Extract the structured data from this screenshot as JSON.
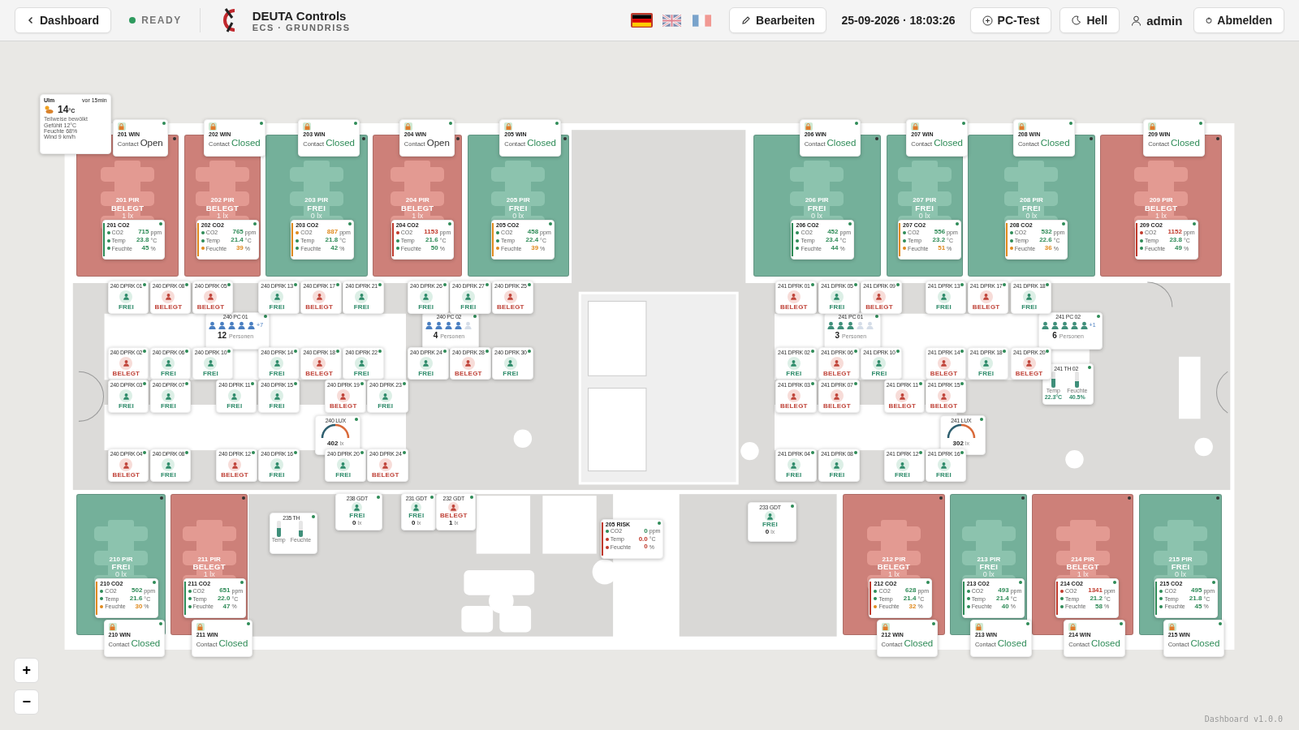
{
  "header": {
    "back": "Dashboard",
    "status": "READY",
    "brand": "DEUTA Controls",
    "subtitle": "ECS · GRUNDRISS",
    "languages": [
      {
        "kind": "de",
        "selected": true
      },
      {
        "kind": "en",
        "selected": false
      },
      {
        "kind": "fr",
        "selected": false
      }
    ],
    "edit": "Bearbeiten",
    "datetime": "25-09-2026 · 18:03:26",
    "pc_test": "PC-Test",
    "theme": "Hell",
    "user": "admin",
    "logout": "Abmelden"
  },
  "weather": {
    "city": "Ulm",
    "age": "vor 15min",
    "temp": "14",
    "unit": "°C",
    "condition": "Teilweise bewölkt",
    "details": [
      "Gefühlt 12°C",
      "Feuchte 68%",
      "Wind 9 km/h"
    ]
  },
  "rooms": [
    {
      "name": "201 PIR",
      "status": "BELEGT",
      "lux": "1 lx",
      "occupied": true
    },
    {
      "name": "202 PIR",
      "status": "BELEGT",
      "lux": "1 lx",
      "occupied": true
    },
    {
      "name": "203 PIR",
      "status": "FREI",
      "lux": "0 lx",
      "occupied": false
    },
    {
      "name": "204 PIR",
      "status": "BELEGT",
      "lux": "1 lx",
      "occupied": true
    },
    {
      "name": "205 PIR",
      "status": "FREI",
      "lux": "0 lx",
      "occupied": false
    },
    {
      "name": "206 PIR",
      "status": "FREI",
      "lux": "0 lx",
      "occupied": false
    },
    {
      "name": "207 PIR",
      "status": "FREI",
      "lux": "0 lx",
      "occupied": false
    },
    {
      "name": "208 PIR",
      "status": "FREI",
      "lux": "0 lx",
      "occupied": false
    },
    {
      "name": "209 PIR",
      "status": "BELEGT",
      "lux": "1 lx",
      "occupied": true
    },
    {
      "name": "210 PIR",
      "status": "FREI",
      "lux": "0 lx",
      "occupied": false
    },
    {
      "name": "211 PIR",
      "status": "BELEGT",
      "lux": "1 lx",
      "occupied": true
    },
    {
      "name": "212 PIR",
      "status": "BELEGT",
      "lux": "1 lx",
      "occupied": true
    },
    {
      "name": "213 PIR",
      "status": "FREI",
      "lux": "0 lx",
      "occupied": false
    },
    {
      "name": "214 PIR",
      "status": "BELEGT",
      "lux": "1 lx",
      "occupied": true
    },
    {
      "name": "215 PIR",
      "status": "FREI",
      "lux": "0 lx",
      "occupied": false
    }
  ],
  "windows": [
    {
      "name": "201 WIN",
      "label": "Contact",
      "value": "Open",
      "closed": false
    },
    {
      "name": "202 WIN",
      "label": "Contact",
      "value": "Closed",
      "closed": true
    },
    {
      "name": "203 WIN",
      "label": "Contact",
      "value": "Closed",
      "closed": true
    },
    {
      "name": "204 WIN",
      "label": "Contact",
      "value": "Open",
      "closed": false
    },
    {
      "name": "205 WIN",
      "label": "Contact",
      "value": "Closed",
      "closed": true
    },
    {
      "name": "206 WIN",
      "label": "Contact",
      "value": "Closed",
      "closed": true
    },
    {
      "name": "207 WIN",
      "label": "Contact",
      "value": "Closed",
      "closed": true
    },
    {
      "name": "208 WIN",
      "label": "Contact",
      "value": "Closed",
      "closed": true
    },
    {
      "name": "209 WIN",
      "label": "Contact",
      "value": "Closed",
      "closed": true
    },
    {
      "name": "210 WIN",
      "label": "Contact",
      "value": "Closed",
      "closed": true
    },
    {
      "name": "211 WIN",
      "label": "Contact",
      "value": "Closed",
      "closed": true
    },
    {
      "name": "212 WIN",
      "label": "Contact",
      "value": "Closed",
      "closed": true
    },
    {
      "name": "213 WIN",
      "label": "Contact",
      "value": "Closed",
      "closed": true
    },
    {
      "name": "214 WIN",
      "label": "Contact",
      "value": "Closed",
      "closed": true
    },
    {
      "name": "215 WIN",
      "label": "Contact",
      "value": "Closed",
      "closed": true
    }
  ],
  "sensors": [
    {
      "name": "201 CO2",
      "color": "#2e8b57",
      "metrics": [
        {
          "label": "CO2",
          "value": "715",
          "unit": "ppm",
          "color": "#2e8b57"
        },
        {
          "label": "Temp",
          "value": "23.8",
          "unit": "°C",
          "color": "#2e8b57"
        },
        {
          "label": "Feuchte",
          "value": "45",
          "unit": "%",
          "color": "#2e8b57"
        }
      ]
    },
    {
      "name": "202 CO2",
      "color": "#e08a1e",
      "metrics": [
        {
          "label": "CO2",
          "value": "765",
          "unit": "ppm",
          "color": "#2e8b57"
        },
        {
          "label": "Temp",
          "value": "21.4",
          "unit": "°C",
          "color": "#2e8b57"
        },
        {
          "label": "Feuchte",
          "value": "39",
          "unit": "%",
          "color": "#e08a1e"
        }
      ]
    },
    {
      "name": "203 CO2",
      "color": "#e08a1e",
      "metrics": [
        {
          "label": "CO2",
          "value": "887",
          "unit": "ppm",
          "color": "#e08a1e"
        },
        {
          "label": "Temp",
          "value": "21.8",
          "unit": "°C",
          "color": "#2e8b57"
        },
        {
          "label": "Feuchte",
          "value": "42",
          "unit": "%",
          "color": "#2e8b57"
        }
      ]
    },
    {
      "name": "204 CO2",
      "color": "#c0392b",
      "metrics": [
        {
          "label": "CO2",
          "value": "1153",
          "unit": "ppm",
          "color": "#c0392b"
        },
        {
          "label": "Temp",
          "value": "21.6",
          "unit": "°C",
          "color": "#2e8b57"
        },
        {
          "label": "Feuchte",
          "value": "50",
          "unit": "%",
          "color": "#2e8b57"
        }
      ]
    },
    {
      "name": "205 CO2",
      "color": "#e08a1e",
      "metrics": [
        {
          "label": "CO2",
          "value": "458",
          "unit": "ppm",
          "color": "#2e8b57"
        },
        {
          "label": "Temp",
          "value": "22.4",
          "unit": "°C",
          "color": "#2e8b57"
        },
        {
          "label": "Feuchte",
          "value": "39",
          "unit": "%",
          "color": "#e08a1e"
        }
      ]
    },
    {
      "name": "206 CO2",
      "color": "#2e8b57",
      "metrics": [
        {
          "label": "CO2",
          "value": "452",
          "unit": "ppm",
          "color": "#2e8b57"
        },
        {
          "label": "Temp",
          "value": "23.4",
          "unit": "°C",
          "color": "#2e8b57"
        },
        {
          "label": "Feuchte",
          "value": "44",
          "unit": "%",
          "color": "#2e8b57"
        }
      ]
    },
    {
      "name": "207 CO2",
      "color": "#e08a1e",
      "metrics": [
        {
          "label": "CO2",
          "value": "556",
          "unit": "ppm",
          "color": "#2e8b57"
        },
        {
          "label": "Temp",
          "value": "23.2",
          "unit": "°C",
          "color": "#2e8b57"
        },
        {
          "label": "Feuchte",
          "value": "51",
          "unit": "%",
          "color": "#e08a1e"
        }
      ]
    },
    {
      "name": "208 CO2",
      "color": "#e08a1e",
      "metrics": [
        {
          "label": "CO2",
          "value": "532",
          "unit": "ppm",
          "color": "#2e8b57"
        },
        {
          "label": "Temp",
          "value": "22.6",
          "unit": "°C",
          "color": "#2e8b57"
        },
        {
          "label": "Feuchte",
          "value": "36",
          "unit": "%",
          "color": "#e08a1e"
        }
      ]
    },
    {
      "name": "209 CO2",
      "color": "#c0392b",
      "metrics": [
        {
          "label": "CO2",
          "value": "1152",
          "unit": "ppm",
          "color": "#c0392b"
        },
        {
          "label": "Temp",
          "value": "23.8",
          "unit": "°C",
          "color": "#2e8b57"
        },
        {
          "label": "Feuchte",
          "value": "49",
          "unit": "%",
          "color": "#2e8b57"
        }
      ]
    },
    {
      "name": "210 CO2",
      "color": "#e08a1e",
      "metrics": [
        {
          "label": "CO2",
          "value": "502",
          "unit": "ppm",
          "color": "#2e8b57"
        },
        {
          "label": "Temp",
          "value": "21.6",
          "unit": "°C",
          "color": "#2e8b57"
        },
        {
          "label": "Feuchte",
          "value": "30",
          "unit": "%",
          "color": "#e08a1e"
        }
      ]
    },
    {
      "name": "211 CO2",
      "color": "#2e8b57",
      "metrics": [
        {
          "label": "CO2",
          "value": "651",
          "unit": "ppm",
          "color": "#2e8b57"
        },
        {
          "label": "Temp",
          "value": "22.0",
          "unit": "°C",
          "color": "#2e8b57"
        },
        {
          "label": "Feuchte",
          "value": "47",
          "unit": "%",
          "color": "#2e8b57"
        }
      ]
    },
    {
      "name": "212 CO2",
      "color": "#c0392b",
      "metrics": [
        {
          "label": "CO2",
          "value": "628",
          "unit": "ppm",
          "color": "#2e8b57"
        },
        {
          "label": "Temp",
          "value": "21.4",
          "unit": "°C",
          "color": "#2e8b57"
        },
        {
          "label": "Feuchte",
          "value": "32",
          "unit": "%",
          "color": "#e08a1e"
        }
      ]
    },
    {
      "name": "213 CO2",
      "color": "#2e8b57",
      "metrics": [
        {
          "label": "CO2",
          "value": "493",
          "unit": "ppm",
          "color": "#2e8b57"
        },
        {
          "label": "Temp",
          "value": "21.4",
          "unit": "°C",
          "color": "#2e8b57"
        },
        {
          "label": "Feuchte",
          "value": "40",
          "unit": "%",
          "color": "#2e8b57"
        }
      ]
    },
    {
      "name": "214 CO2",
      "color": "#c0392b",
      "metrics": [
        {
          "label": "CO2",
          "value": "1341",
          "unit": "ppm",
          "color": "#c0392b"
        },
        {
          "label": "Temp",
          "value": "21.2",
          "unit": "°C",
          "color": "#2e8b57"
        },
        {
          "label": "Feuchte",
          "value": "58",
          "unit": "%",
          "color": "#2e8b57"
        }
      ]
    },
    {
      "name": "215 CO2",
      "color": "#2e8b57",
      "metrics": [
        {
          "label": "CO2",
          "value": "495",
          "unit": "ppm",
          "color": "#2e8b57"
        },
        {
          "label": "Temp",
          "value": "21.8",
          "unit": "°C",
          "color": "#2e8b57"
        },
        {
          "label": "Feuchte",
          "value": "45",
          "unit": "%",
          "color": "#2e8b57"
        }
      ]
    },
    {
      "name": "205 RISK",
      "color": "#c0392b",
      "metrics": [
        {
          "label": "CO2",
          "value": "0",
          "unit": "ppm",
          "color": "#2e8b57"
        },
        {
          "label": "Temp",
          "value": "0.0",
          "unit": "°C",
          "color": "#c0392b"
        },
        {
          "label": "Feuchte",
          "value": "0",
          "unit": "%",
          "color": "#c0392b"
        }
      ]
    }
  ],
  "counters": [
    {
      "name": "240 PC 01",
      "count": "12",
      "unit": "Personen",
      "extra": "+7",
      "color": "#4a7fc1",
      "icons": [
        {
          "filled": true
        },
        {
          "filled": true
        },
        {
          "filled": true
        },
        {
          "filled": true
        },
        {
          "filled": true
        }
      ]
    },
    {
      "name": "240 PC 02",
      "count": "4",
      "unit": "Personen",
      "color": "#4a7fc1",
      "icons": [
        {
          "filled": true
        },
        {
          "filled": true
        },
        {
          "filled": true
        },
        {
          "filled": true
        },
        {
          "filled": false
        }
      ]
    },
    {
      "name": "241 PC 01",
      "count": "3",
      "unit": "Personen",
      "color": "#3f8f7a",
      "icons": [
        {
          "filled": true
        },
        {
          "filled": true
        },
        {
          "filled": true
        },
        {
          "filled": false
        },
        {
          "filled": false
        }
      ]
    },
    {
      "name": "241 PC 02",
      "count": "6",
      "unit": "Personen",
      "extra": "+1",
      "color": "#3f8f7a",
      "icons": [
        {
          "filled": true
        },
        {
          "filled": true
        },
        {
          "filled": true
        },
        {
          "filled": true
        },
        {
          "filled": true
        }
      ]
    }
  ],
  "climate": [
    {
      "name": "235 TH",
      "bars": [
        {
          "label": "Temp",
          "level": 0.55
        },
        {
          "label": "Feuchte",
          "level": 0.4
        }
      ]
    },
    {
      "name": "241 TH 02",
      "bars": [
        {
          "label": "Temp",
          "level": 0.55,
          "value": "22.3°C"
        },
        {
          "label": "Feuchte",
          "level": 0.4,
          "value": "40.5%"
        }
      ]
    }
  ],
  "gauges": [
    {
      "name": "240 LUX",
      "value": "402",
      "unit": "lx"
    },
    {
      "name": "241 LUX",
      "value": "302",
      "unit": "lx"
    }
  ],
  "desks": [
    {
      "name": "240 DPRK 01",
      "status": "FREI",
      "occupied": false
    },
    {
      "name": "240 DPRK 08",
      "status": "BELEGT",
      "occupied": true
    },
    {
      "name": "240 DPRK 05",
      "status": "BELEGT",
      "occupied": true
    },
    {
      "name": "240 DPRK 13",
      "status": "FREI",
      "occupied": false
    },
    {
      "name": "240 DPRK 17",
      "status": "BELEGT",
      "occupied": true
    },
    {
      "name": "240 DPRK 21",
      "status": "FREI",
      "occupied": false
    },
    {
      "name": "240 DPRK 26",
      "status": "FREI",
      "occupied": false
    },
    {
      "name": "240 DPRK 27",
      "status": "FREI",
      "occupied": false
    },
    {
      "name": "240 DPRK 25",
      "status": "BELEGT",
      "occupied": true
    },
    {
      "name": "240 DPRK 02",
      "status": "BELEGT",
      "occupied": true
    },
    {
      "name": "240 DPRK 06",
      "status": "FREI",
      "occupied": false
    },
    {
      "name": "240 DPRK 10",
      "status": "FREI",
      "occupied": false
    },
    {
      "name": "240 DPRK 14",
      "status": "FREI",
      "occupied": false
    },
    {
      "name": "240 DPRK 18",
      "status": "BELEGT",
      "occupied": true
    },
    {
      "name": "240 DPRK 22",
      "status": "FREI",
      "occupied": false
    },
    {
      "name": "240 DPRK 24",
      "status": "FREI",
      "occupied": false
    },
    {
      "name": "240 DPRK 28",
      "status": "BELEGT",
      "occupied": true
    },
    {
      "name": "240 DPRK 30",
      "status": "FREI",
      "occupied": false
    },
    {
      "name": "240 DPRK 03",
      "status": "FREI",
      "occupied": false
    },
    {
      "name": "240 DPRK 07",
      "status": "FREI",
      "occupied": false
    },
    {
      "name": "240 DPRK 11",
      "status": "FREI",
      "occupied": false
    },
    {
      "name": "240 DPRK 15",
      "status": "FREI",
      "occupied": false
    },
    {
      "name": "240 DPRK 19",
      "status": "BELEGT",
      "occupied": true
    },
    {
      "name": "240 DPRK 23",
      "status": "FREI",
      "occupied": false
    },
    {
      "name": "240 DPRK 04",
      "status": "BELEGT",
      "occupied": true
    },
    {
      "name": "240 DPRK 08",
      "status": "FREI",
      "occupied": false
    },
    {
      "name": "240 DPRK 12",
      "status": "BELEGT",
      "occupied": true
    },
    {
      "name": "240 DPRK 16",
      "status": "FREI",
      "occupied": false
    },
    {
      "name": "240 DPRK 20",
      "status": "FREI",
      "occupied": false
    },
    {
      "name": "240 DPRK 24",
      "status": "BELEGT",
      "occupied": true
    },
    {
      "name": "241 DPRK 01",
      "status": "BELEGT",
      "occupied": true
    },
    {
      "name": "241 DPRK 05",
      "status": "FREI",
      "occupied": false
    },
    {
      "name": "241 DPRK 09",
      "status": "BELEGT",
      "occupied": true
    },
    {
      "name": "241 DPRK 13",
      "status": "FREI",
      "occupied": false
    },
    {
      "name": "241 DPRK 17",
      "status": "BELEGT",
      "occupied": true
    },
    {
      "name": "241 DPRK 18",
      "status": "FREI",
      "occupied": false
    },
    {
      "name": "241 DPRK 02",
      "status": "FREI",
      "occupied": false
    },
    {
      "name": "241 DPRK 06",
      "status": "BELEGT",
      "occupied": true
    },
    {
      "name": "241 DPRK 10",
      "status": "FREI",
      "occupied": false
    },
    {
      "name": "241 DPRK 14",
      "status": "BELEGT",
      "occupied": true
    },
    {
      "name": "241 DPRK 18",
      "status": "FREI",
      "occupied": false
    },
    {
      "name": "241 DPRK 20",
      "status": "BELEGT",
      "occupied": true
    },
    {
      "name": "241 DPRK 03",
      "status": "BELEGT",
      "occupied": true
    },
    {
      "name": "241 DPRK 07",
      "status": "BELEGT",
      "occupied": true
    },
    {
      "name": "241 DPRK 11",
      "status": "BELEGT",
      "occupied": true
    },
    {
      "name": "241 DPRK 15",
      "status": "BELEGT",
      "occupied": true
    },
    {
      "name": "241 DPRK 04",
      "status": "FREI",
      "occupied": false
    },
    {
      "name": "241 DPRK 08",
      "status": "FREI",
      "occupied": false
    },
    {
      "name": "241 DPRK 12",
      "status": "FREI",
      "occupied": false
    },
    {
      "name": "241 DPRK 16",
      "status": "FREI",
      "occupied": false
    }
  ],
  "gdt": [
    {
      "name": "238 GDT",
      "status": "FREI",
      "count": "0",
      "unit": "lx",
      "occupied": false
    },
    {
      "name": "231 GDT",
      "status": "FREI",
      "count": "0",
      "unit": "lx",
      "occupied": false
    },
    {
      "name": "232 GDT",
      "status": "BELEGT",
      "count": "1",
      "unit": "lx",
      "occupied": true
    },
    {
      "name": "233 GDT",
      "status": "FREI",
      "count": "0",
      "unit": "lx",
      "occupied": false
    }
  ],
  "zoom": {
    "zoom_in": "+",
    "zoom_out": "−"
  },
  "footer": "Dashboard v1.0.0"
}
